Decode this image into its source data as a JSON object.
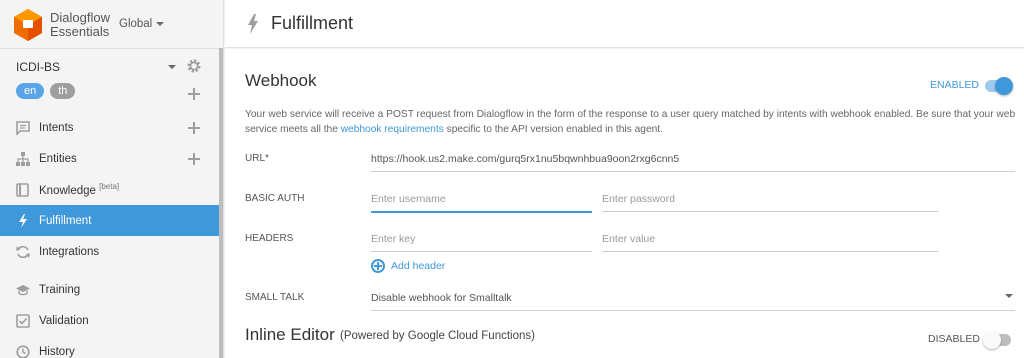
{
  "brand": {
    "line1": "Dialogflow",
    "line2": "Essentials",
    "region": "Global",
    "logo_color": "#ef6c00"
  },
  "agent": {
    "name": "ICDI-BS",
    "languages": [
      "en",
      "th"
    ]
  },
  "nav": {
    "items": [
      {
        "label": "Intents",
        "icon": "chat-icon"
      },
      {
        "label": "Entities",
        "icon": "sitemap-icon"
      },
      {
        "label": "Knowledge",
        "badge": "[beta]",
        "icon": "book-icon"
      },
      {
        "label": "Fulfillment",
        "icon": "bolt-icon",
        "active": true
      },
      {
        "label": "Integrations",
        "icon": "sync-icon"
      },
      {
        "label": "Training",
        "icon": "graduation-cap-icon"
      },
      {
        "label": "Validation",
        "icon": "check-box-icon"
      },
      {
        "label": "History",
        "icon": "clock-icon"
      }
    ],
    "active_color": "#3f98d9"
  },
  "page": {
    "title": "Fulfillment"
  },
  "webhook": {
    "title": "Webhook",
    "status": "ENABLED",
    "enabled": true,
    "description_before": "Your web service will receive a POST request from Dialogflow in the form of the response to a user query matched by intents with webhook enabled. Be sure that your web service meets all the ",
    "description_link": "webhook requirements",
    "description_after": " specific to the API version enabled in this agent.",
    "url_label": "URL*",
    "url_value": "https://hook.us2.make.com/gurq5rx1nu5bqwnhbua9oon2rxg6cnn5",
    "basic_auth_label": "BASIC AUTH",
    "username_placeholder": "Enter username",
    "password_placeholder": "Enter password",
    "headers_label": "HEADERS",
    "key_placeholder": "Enter key",
    "value_placeholder": "Enter value",
    "add_header": "Add header",
    "small_talk_label": "SMALL TALK",
    "small_talk_value": "Disable webhook for Smalltalk"
  },
  "inline_editor": {
    "title": "Inline Editor",
    "subtitle": "(Powered by Google Cloud Functions)",
    "status": "DISABLED",
    "enabled": false
  }
}
